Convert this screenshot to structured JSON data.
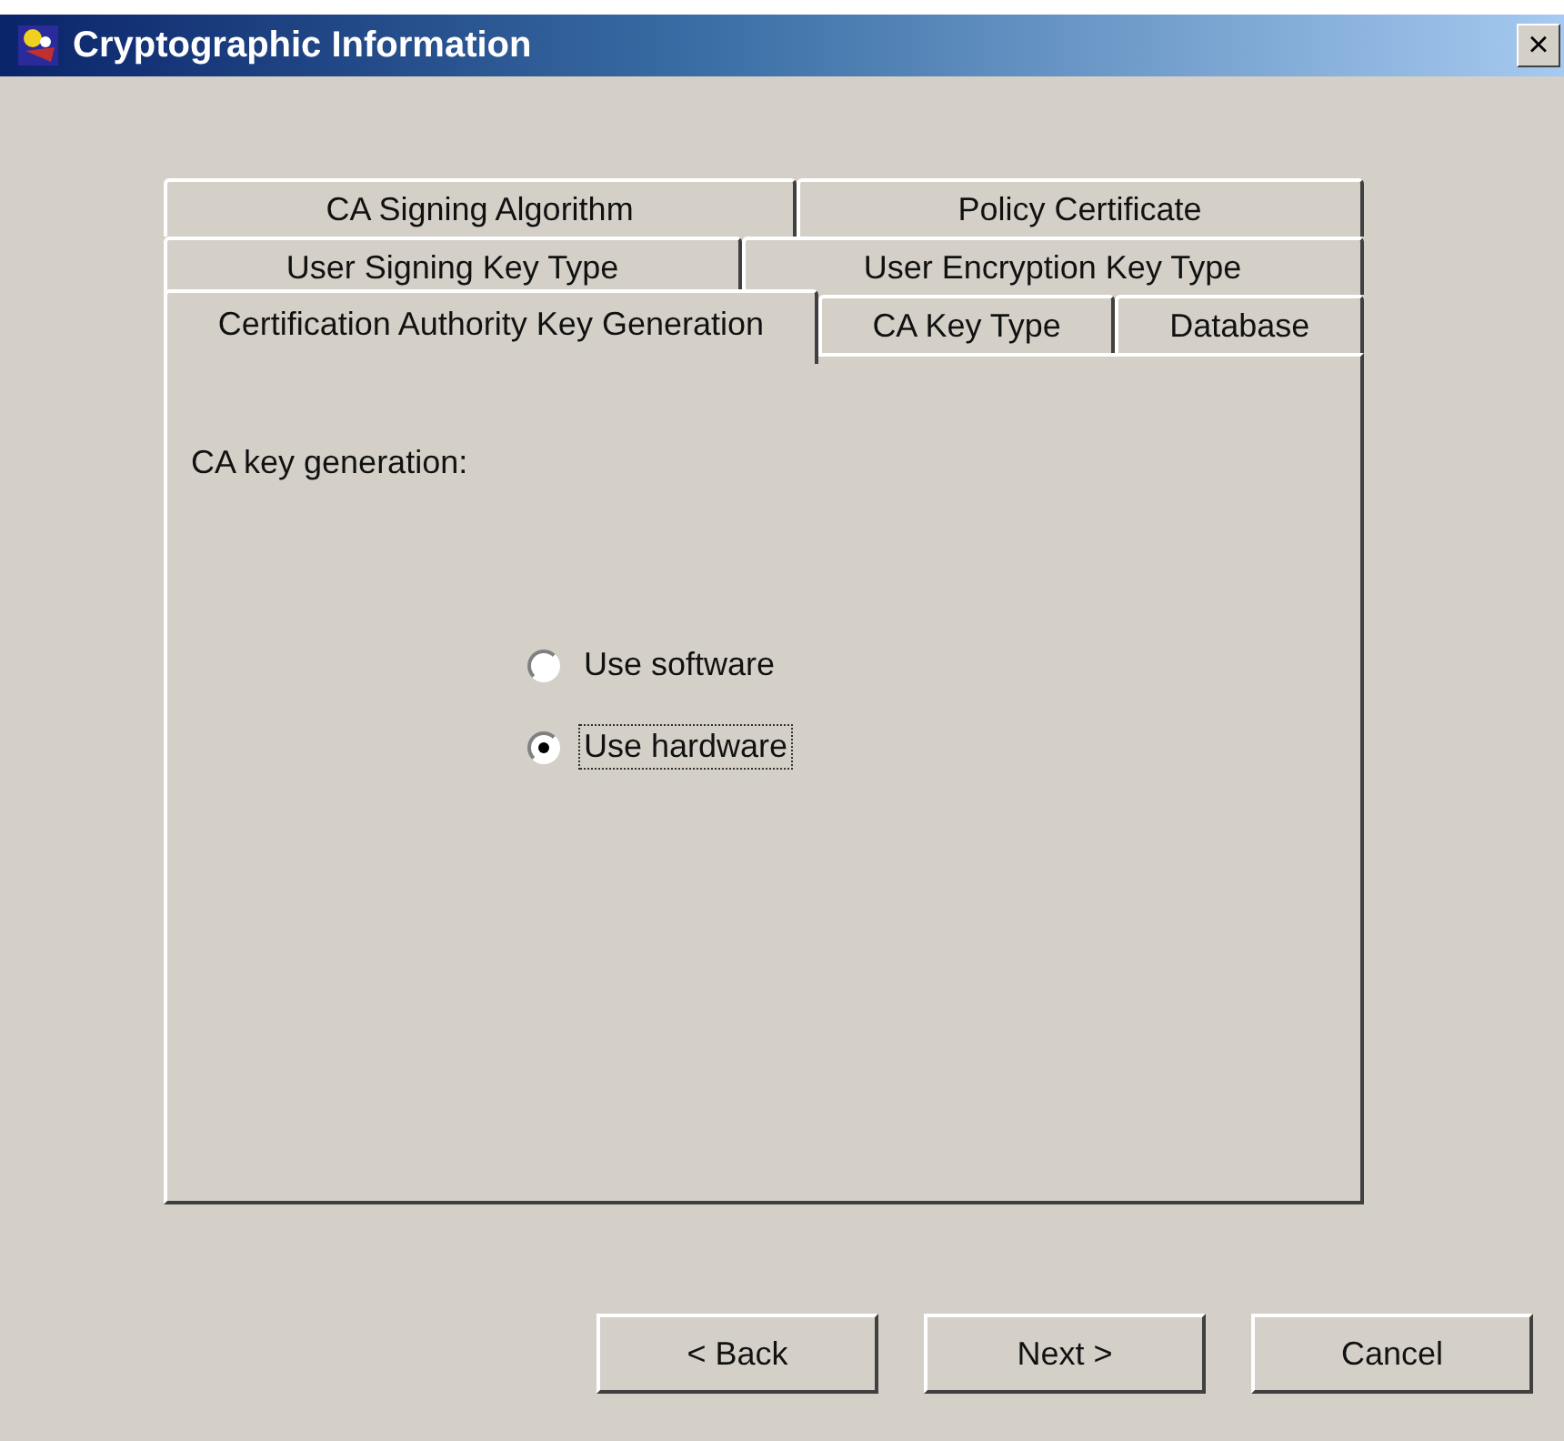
{
  "window": {
    "title": "Cryptographic Information",
    "close": "×"
  },
  "tab_rows": [
    [
      {
        "label": "CA Signing Algorithm",
        "selected": false
      },
      {
        "label": "Policy Certificate",
        "selected": false
      }
    ],
    [
      {
        "label": "User Signing Key Type",
        "selected": false
      },
      {
        "label": "User Encryption Key Type",
        "selected": false
      }
    ],
    [
      {
        "label": "Certification Authority Key Generation",
        "selected": true
      },
      {
        "label": "CA Key Type",
        "selected": false
      },
      {
        "label": "Database",
        "selected": false
      }
    ]
  ],
  "panel": {
    "label": "CA key generation:",
    "options": [
      {
        "label": "Use software",
        "selected": false
      },
      {
        "label": "Use hardware",
        "selected": true
      }
    ]
  },
  "buttons": [
    "< Back",
    "Next >",
    "Cancel"
  ]
}
